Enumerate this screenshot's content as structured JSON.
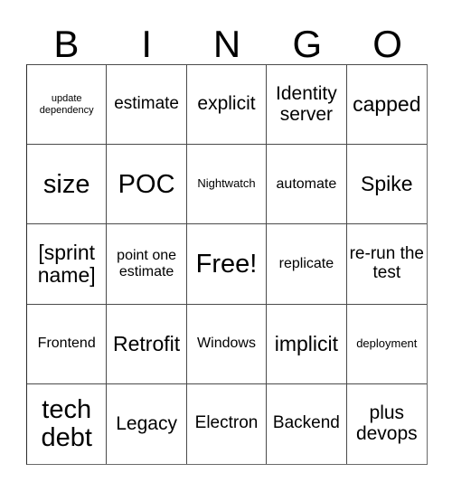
{
  "card": {
    "title": "BINGO",
    "headers": [
      "B",
      "I",
      "N",
      "G",
      "O"
    ],
    "free_space_label": "Free!",
    "colors": {
      "text": "#000000",
      "background": "#ffffff",
      "border": "#4a4a4a"
    },
    "rows": [
      [
        {
          "label": "update dependency",
          "size": "xs"
        },
        {
          "label": "estimate",
          "size": "lg"
        },
        {
          "label": "explicit",
          "size": "xl"
        },
        {
          "label": "Identity server",
          "size": "xl"
        },
        {
          "label": "capped",
          "size": "xxl"
        }
      ],
      [
        {
          "label": "size",
          "size": "huge"
        },
        {
          "label": "POC",
          "size": "huge"
        },
        {
          "label": "Nightwatch",
          "size": "sm"
        },
        {
          "label": "automate",
          "size": "md"
        },
        {
          "label": "Spike",
          "size": "xxl"
        }
      ],
      [
        {
          "label": "[sprint name]",
          "size": "xxl"
        },
        {
          "label": "point one estimate",
          "size": "md"
        },
        {
          "label": "Free!",
          "size": "huge"
        },
        {
          "label": "replicate",
          "size": "md"
        },
        {
          "label": "re-run the test",
          "size": "lg"
        }
      ],
      [
        {
          "label": "Frontend",
          "size": "md"
        },
        {
          "label": "Retrofit",
          "size": "xxl"
        },
        {
          "label": "Windows",
          "size": "md"
        },
        {
          "label": "implicit",
          "size": "xxl"
        },
        {
          "label": "deployment",
          "size": "sm"
        }
      ],
      [
        {
          "label": "tech debt",
          "size": "huge"
        },
        {
          "label": "Legacy",
          "size": "xl"
        },
        {
          "label": "Electron",
          "size": "lg"
        },
        {
          "label": "Backend",
          "size": "lg"
        },
        {
          "label": "plus devops",
          "size": "xl"
        }
      ]
    ]
  }
}
